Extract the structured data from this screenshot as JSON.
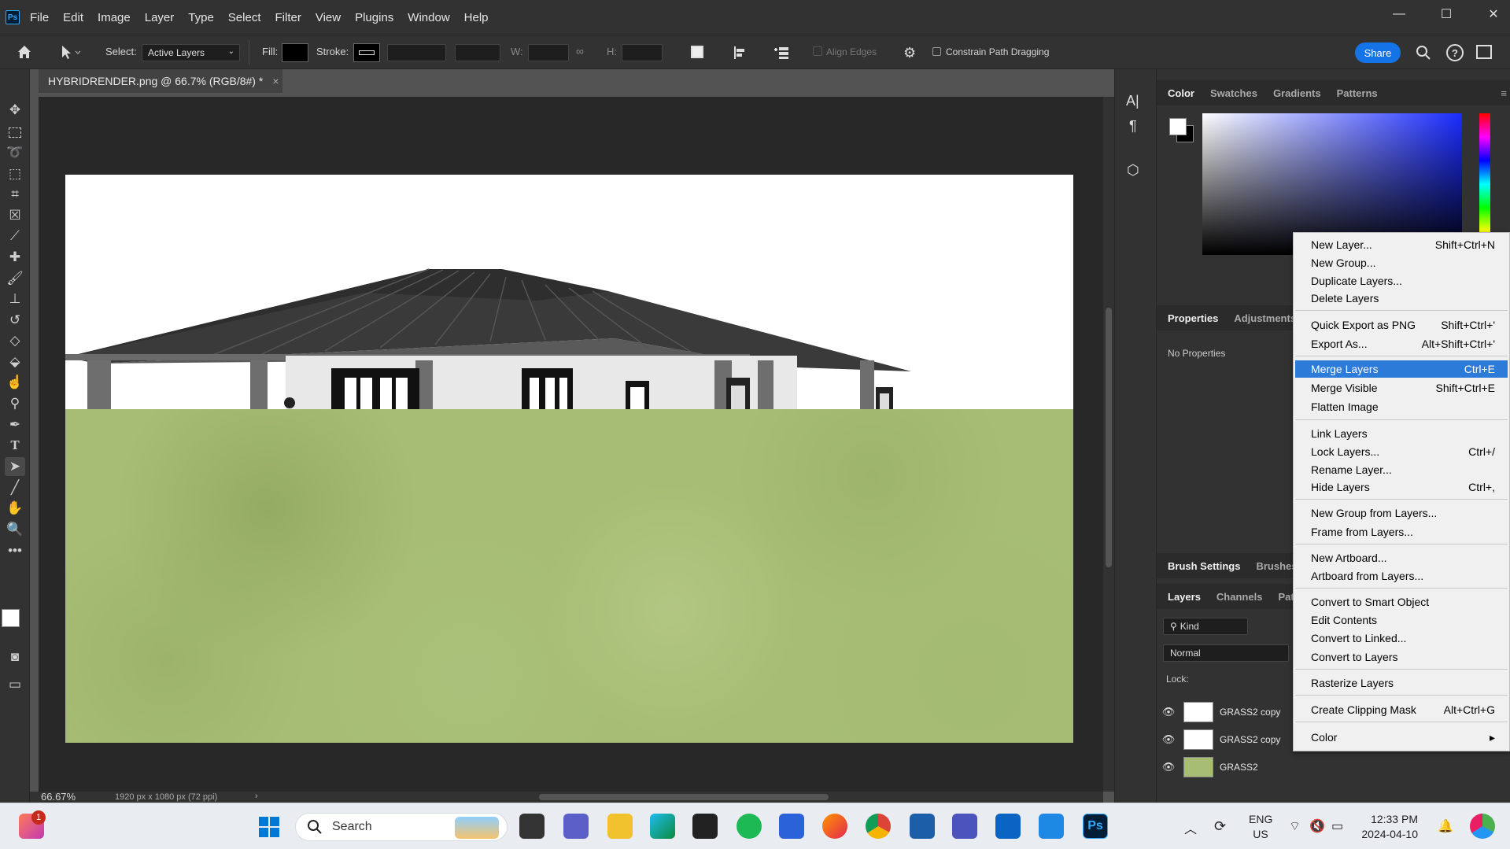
{
  "app": {
    "logo": "Ps"
  },
  "menu": [
    "File",
    "Edit",
    "Image",
    "Layer",
    "Type",
    "Select",
    "Filter",
    "View",
    "Plugins",
    "Window",
    "Help"
  ],
  "window_controls": {
    "minimize": "—",
    "maximize": "☐",
    "close": "✕"
  },
  "options": {
    "select_label": "Select:",
    "select_value": "Active Layers",
    "fill_label": "Fill:",
    "stroke_label": "Stroke:",
    "w_label": "W:",
    "h_label": "H:",
    "align_edges": "Align Edges",
    "constrain": "Constrain Path Dragging",
    "share": "Share"
  },
  "document": {
    "tab_title": "HYBRIDRENDER.png @ 66.7% (RGB/8#) *",
    "zoom": "66.67%",
    "info": "1920 px x 1080 px (72 ppi)"
  },
  "panels": {
    "color_tabs": [
      "Color",
      "Swatches",
      "Gradients",
      "Patterns"
    ],
    "properties_tabs": [
      "Properties",
      "Adjustments"
    ],
    "no_properties": "No Properties",
    "brush_tabs": [
      "Brush Settings",
      "Brushes"
    ],
    "layers_tabs": [
      "Layers",
      "Channels",
      "Path"
    ],
    "kind": "Kind",
    "blend_mode": "Normal",
    "lock_label": "Lock:",
    "layers": [
      "GRASS2 copy",
      "GRASS2 copy",
      "GRASS2"
    ]
  },
  "context_menu": [
    {
      "label": "New Layer...",
      "shortcut": "Shift+Ctrl+N"
    },
    {
      "label": "New Group...",
      "shortcut": ""
    },
    {
      "label": "Duplicate Layers...",
      "shortcut": ""
    },
    {
      "label": "Delete Layers",
      "shortcut": ""
    },
    {
      "label": "Quick Export as PNG",
      "shortcut": "Shift+Ctrl+'"
    },
    {
      "label": "Export As...",
      "shortcut": "Alt+Shift+Ctrl+'"
    },
    {
      "label": "Merge Layers",
      "shortcut": "Ctrl+E"
    },
    {
      "label": "Merge Visible",
      "shortcut": "Shift+Ctrl+E"
    },
    {
      "label": "Flatten Image",
      "shortcut": ""
    },
    {
      "label": "Link Layers",
      "shortcut": ""
    },
    {
      "label": "Lock Layers...",
      "shortcut": "Ctrl+/"
    },
    {
      "label": "Rename Layer...",
      "shortcut": ""
    },
    {
      "label": "Hide Layers",
      "shortcut": "Ctrl+,"
    },
    {
      "label": "New Group from Layers...",
      "shortcut": ""
    },
    {
      "label": "Frame from Layers...",
      "shortcut": ""
    },
    {
      "label": "New Artboard...",
      "shortcut": ""
    },
    {
      "label": "Artboard from Layers...",
      "shortcut": ""
    },
    {
      "label": "Convert to Smart Object",
      "shortcut": ""
    },
    {
      "label": "Edit Contents",
      "shortcut": ""
    },
    {
      "label": "Convert to Linked...",
      "shortcut": ""
    },
    {
      "label": "Convert to Layers",
      "shortcut": ""
    },
    {
      "label": "Rasterize Layers",
      "shortcut": ""
    },
    {
      "label": "Create Clipping Mask",
      "shortcut": "Alt+Ctrl+G"
    },
    {
      "label": "Color",
      "shortcut": ""
    }
  ],
  "taskbar": {
    "search": "Search",
    "lang1": "ENG",
    "lang2": "US",
    "time": "12:33 PM",
    "date": "2024-04-10",
    "notif_badge": "1",
    "ps_icon": "Ps"
  }
}
